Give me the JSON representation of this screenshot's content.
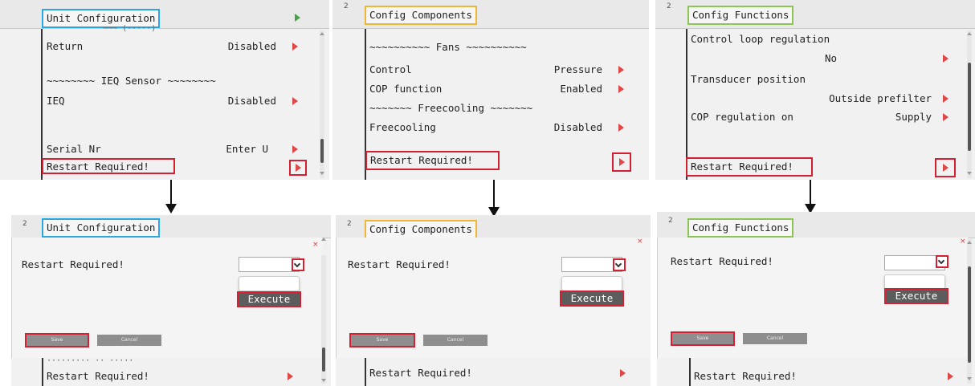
{
  "panel_number": "2",
  "restart_label": "Restart Required!",
  "execute_option": "Execute",
  "save_label": "Save",
  "cancel_label": "Cancel",
  "close_label": "×",
  "unit_config": {
    "title": "Unit Configuration",
    "cut_row": "~~~ (·····)",
    "rows": [
      {
        "label": "Return",
        "value": "Disabled"
      },
      {
        "label": "~~~~~~~~ IEQ Sensor ~~~~~~~~",
        "value": ""
      },
      {
        "label": "IEQ",
        "value": "Disabled"
      },
      {
        "label": "Serial Nr",
        "value": "Enter U"
      }
    ],
    "partial_row": "·········  ·· ·····"
  },
  "config_components": {
    "title": "Config Components",
    "rows": [
      {
        "label": "~~~~~~~~~~ Fans ~~~~~~~~~~",
        "value": ""
      },
      {
        "label": "Control",
        "value": "Pressure"
      },
      {
        "label": "COP function",
        "value": "Enabled"
      },
      {
        "label": "~~~~~~~ Freecooling ~~~~~~~",
        "value": ""
      },
      {
        "label": "Freecooling",
        "value": "Disabled"
      }
    ]
  },
  "config_functions": {
    "title": "Config Functions",
    "rows": [
      {
        "label": "Control loop regulation",
        "value": ""
      },
      {
        "label": "",
        "value": "No"
      },
      {
        "label": "Transducer position",
        "value": ""
      },
      {
        "label": "",
        "value": "Outside prefilter"
      },
      {
        "label": "COP regulation on",
        "value": "Supply"
      }
    ]
  },
  "colors": {
    "unit_config_highlight": "#28a8e0",
    "config_components_highlight": "#f2b636",
    "config_functions_highlight": "#8cc652",
    "action_highlight": "#d42030",
    "arrow": "#e04848"
  }
}
